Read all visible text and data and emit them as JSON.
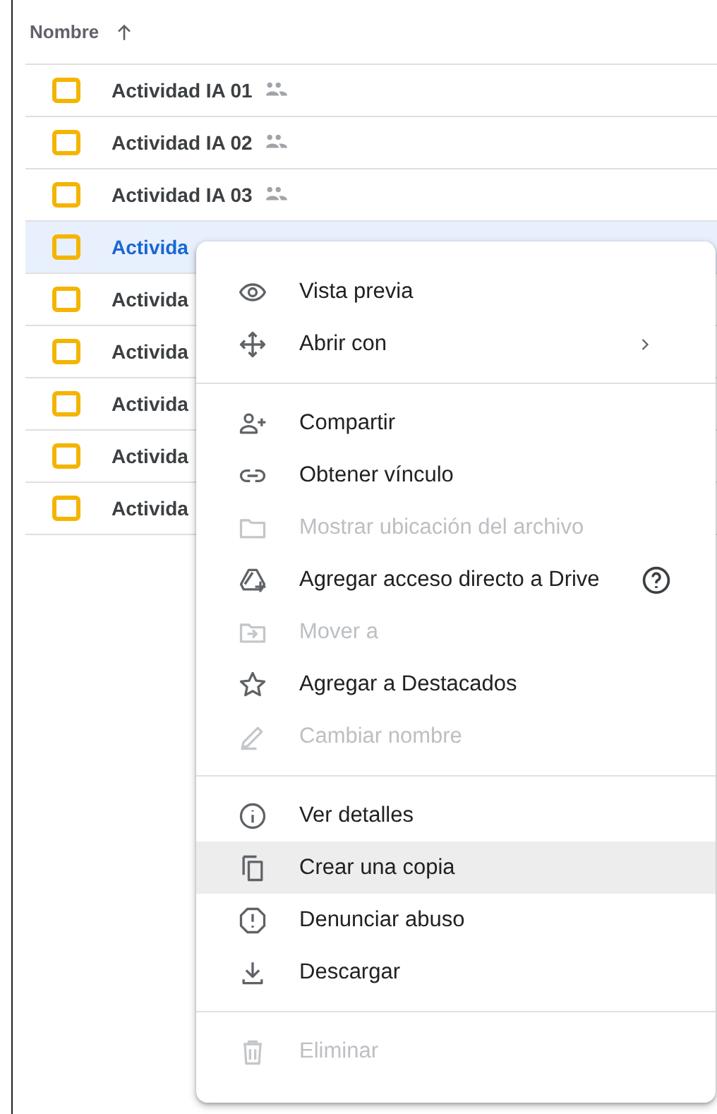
{
  "header": {
    "label": "Nombre",
    "sort_ascending": true
  },
  "rows": [
    {
      "name": "Actividad IA 01",
      "shared": true,
      "selected": false
    },
    {
      "name": "Actividad IA 02",
      "shared": true,
      "selected": false
    },
    {
      "name": "Actividad IA 03",
      "shared": true,
      "selected": false
    },
    {
      "name": "Activida",
      "selected": true
    },
    {
      "name": "Activida",
      "selected": false
    },
    {
      "name": "Activida",
      "selected": false
    },
    {
      "name": "Activida",
      "selected": false
    },
    {
      "name": "Activida",
      "selected": false
    },
    {
      "name": "Activida",
      "selected": false
    }
  ],
  "context_menu": {
    "sections": [
      [
        {
          "label": "Vista previa",
          "disabled": false,
          "hovered": false
        },
        {
          "label": "Abrir con",
          "disabled": false,
          "hovered": false,
          "submenu": true
        }
      ],
      [
        {
          "label": "Compartir",
          "disabled": false,
          "hovered": false
        },
        {
          "label": "Obtener vínculo",
          "disabled": false,
          "hovered": false
        },
        {
          "label": "Mostrar ubicación del archivo",
          "disabled": true,
          "hovered": false
        },
        {
          "label": "Agregar acceso directo a Drive",
          "disabled": false,
          "hovered": false,
          "help": true
        },
        {
          "label": "Mover a",
          "disabled": true,
          "hovered": false
        },
        {
          "label": "Agregar a Destacados",
          "disabled": false,
          "hovered": false
        },
        {
          "label": "Cambiar nombre",
          "disabled": true,
          "hovered": false
        }
      ],
      [
        {
          "label": "Ver detalles",
          "disabled": false,
          "hovered": false
        },
        {
          "label": "Crear una copia",
          "disabled": false,
          "hovered": true
        },
        {
          "label": "Denunciar abuso",
          "disabled": false,
          "hovered": false
        },
        {
          "label": "Descargar",
          "disabled": false,
          "hovered": false
        }
      ],
      [
        {
          "label": "Eliminar",
          "disabled": true,
          "hovered": false
        }
      ]
    ]
  }
}
